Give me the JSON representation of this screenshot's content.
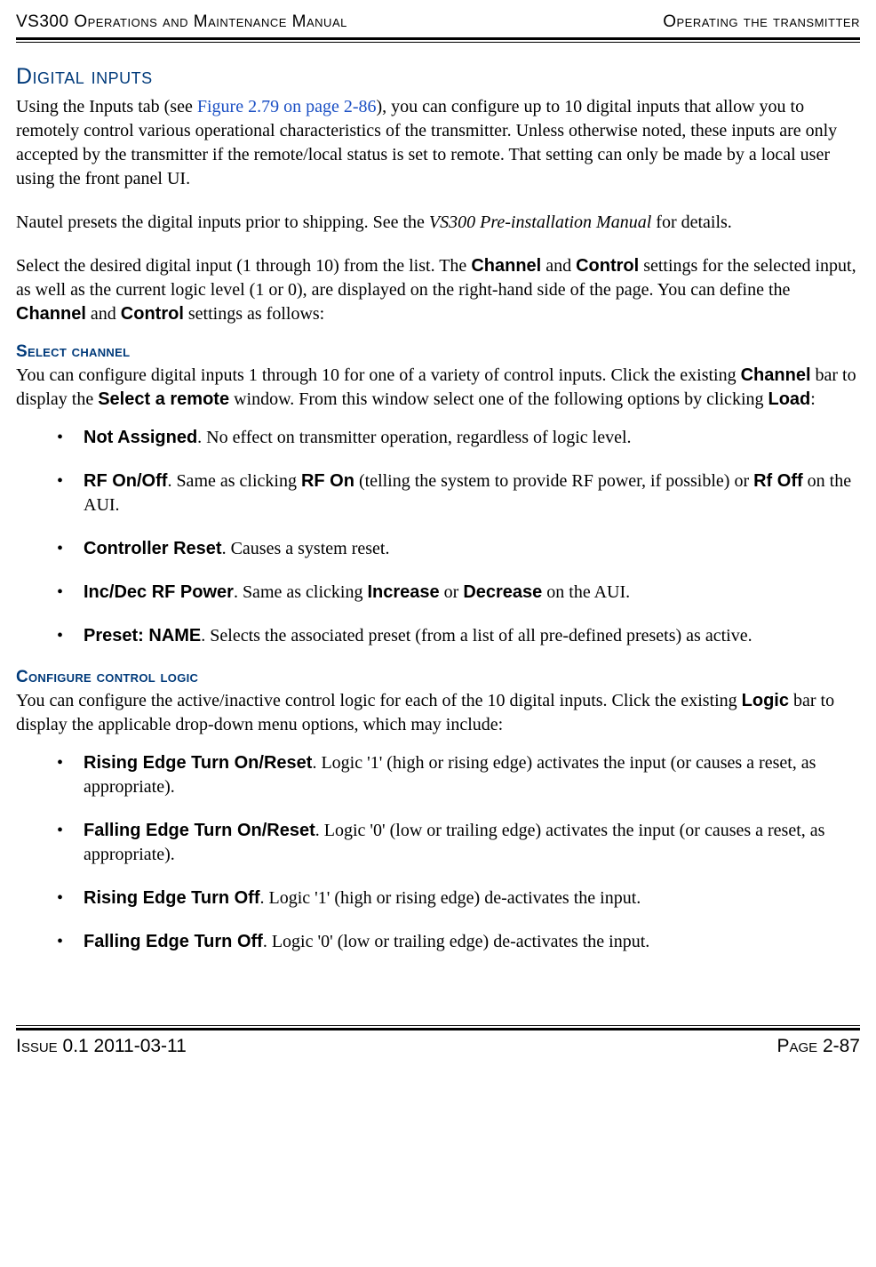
{
  "header": {
    "left": "VS300 Operations and Maintenance Manual",
    "right": "Operating the transmitter"
  },
  "h1": "Digital inputs",
  "intro": {
    "p1_pre": "Using the Inputs tab (see ",
    "p1_link": "Figure 2.79 on page 2-86",
    "p1_post": "), you can configure up to 10 digital inputs that allow you to remotely control various operational characteristics of the transmitter. Unless otherwise noted, these inputs are only accepted by the transmitter if the remote/local status is set to remote. That setting can only be made by a local user using the front panel UI.",
    "p2_pre": "Nautel presets the digital inputs prior to shipping. See the ",
    "p2_em": "VS300 Pre-installation Manual",
    "p2_post": " for details.",
    "p3_a": "Select the desired digital input (1 through 10) from the list. The ",
    "p3_channel": "Channel",
    "p3_b": " and ",
    "p3_control": "Control",
    "p3_c": " settings for the selected input, as well as the current logic level (1 or 0), are displayed on the right-hand side of the page. You can define the ",
    "p3_channel2": "Channel",
    "p3_d": " and ",
    "p3_control2": "Control",
    "p3_e": " settings as follows:"
  },
  "section1": {
    "title": "Select channel",
    "para": {
      "a": "You can configure digital inputs 1 through 10 for one of a variety of control inputs. Click the existing ",
      "channel": "Channel",
      "b": " bar to display the ",
      "select_remote": "Select a remote",
      "c": " window. From this window select one of the following options by clicking ",
      "load": "Load",
      "d": ":"
    },
    "items": [
      {
        "label": "Not Assigned",
        "text": ". No effect on transmitter operation, regardless of logic level."
      },
      {
        "label": "RF On/Off",
        "pre": ". Same as clicking ",
        "mid1": "RF On",
        "mid_text": " (telling the system to provide RF power, if possible) or ",
        "mid2": "Rf Off",
        "post": " on the AUI."
      },
      {
        "label": "Controller Reset",
        "text": ". Causes a system reset."
      },
      {
        "label": "Inc/Dec RF Power",
        "pre": ". Same as clicking ",
        "mid1": "Increase",
        "mid_text": " or ",
        "mid2": "Decrease",
        "post": " on the AUI."
      },
      {
        "label": "Preset: NAME",
        "text": ". Selects the associated preset (from a list of all pre-defined presets) as active."
      }
    ]
  },
  "section2": {
    "title": "Configure control logic",
    "para": {
      "a": "You can configure the active/inactive control logic for each of the 10 digital inputs. Click the existing ",
      "logic": "Logic",
      "b": " bar to display the applicable drop-down menu options, which may include:"
    },
    "items": [
      {
        "label": "Rising Edge Turn On/Reset",
        "text": ". Logic '1' (high or rising edge) activates the input (or causes a reset, as appropriate)."
      },
      {
        "label": "Falling Edge Turn On/Reset",
        "text": ". Logic '0' (low or trailing edge) activates the input (or causes a reset, as appropriate)."
      },
      {
        "label": "Rising Edge Turn Off",
        "text": ". Logic '1' (high or rising edge) de-activates the input."
      },
      {
        "label": "Falling Edge Turn Off",
        "text": ". Logic '0' (low or trailing edge) de-activates the input."
      }
    ]
  },
  "footer": {
    "left": "Issue 0.1  2011-03-11",
    "right": "Page 2-87"
  }
}
